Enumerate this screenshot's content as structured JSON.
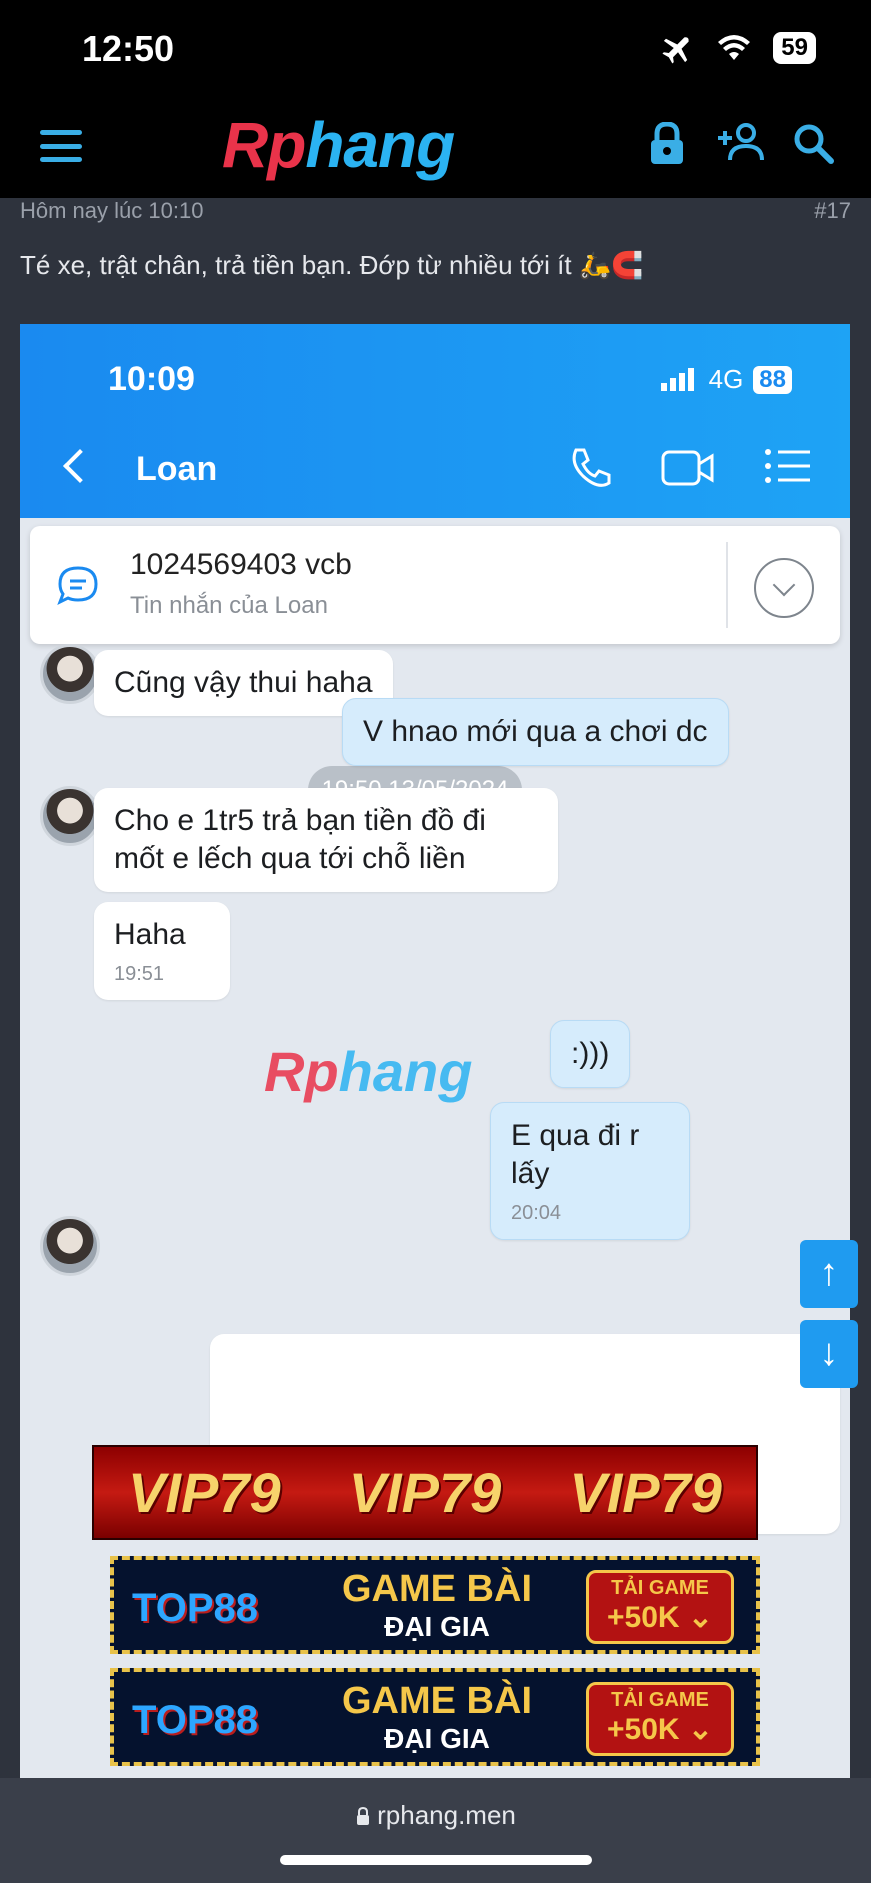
{
  "status_bar": {
    "time": "12:50",
    "battery": "59"
  },
  "header": {
    "logo_part1": "Rp",
    "logo_part2": "hang"
  },
  "post": {
    "meta_time": "Hôm nay lúc 10:10",
    "post_number": "#17",
    "text": "Té xe, trật chân, trả tiền bạn. Đớp từ nhiều tới ít 🛵🧲"
  },
  "screenshot": {
    "status_time": "10:09",
    "network": "4G",
    "battery": "88",
    "chat_title": "Loan",
    "pinned": {
      "title": "1024569403 vcb",
      "subtitle": "Tin nhắn của Loan"
    },
    "messages": [
      {
        "from": "them",
        "text": "Cũng vậy thui haha"
      },
      {
        "from": "date",
        "text": "19:50 13/05/2024"
      },
      {
        "from": "me",
        "text": "V hnao mới qua a chơi dc"
      },
      {
        "from": "them",
        "text": "Cho e 1tr5 trả bạn tiền đồ đi mốt e lếch qua tới chỗ liền"
      },
      {
        "from": "them",
        "text": "Haha",
        "time": "19:51"
      },
      {
        "from": "me",
        "text": ":)))"
      },
      {
        "from": "me",
        "text": "E qua đi r lấy",
        "time": "20:04"
      }
    ],
    "watermark_part1": "Rp",
    "watermark_part2": "hang"
  },
  "ads": {
    "vip": [
      "VIP79",
      "VIP79",
      "VIP79"
    ],
    "top88": {
      "logo": "TOP88",
      "line1": "GAME BÀI",
      "line2": "ĐẠI GIA",
      "cta1": "TẢI GAME",
      "cta2": "+50K ⌄"
    },
    "close": "✕"
  },
  "scroll": {
    "up": "↑",
    "down": "↓"
  },
  "bottom": {
    "url": "rphang.men"
  }
}
